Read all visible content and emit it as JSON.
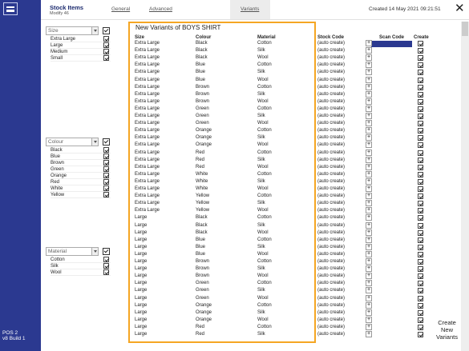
{
  "sidebar": {
    "pos_line1": "POS 2",
    "pos_line2": "v8 Build 1"
  },
  "header": {
    "title": "Stock Items",
    "subtitle": "Modify 46",
    "tabs": [
      "General",
      "Advanced",
      "",
      "Variants"
    ],
    "created": "Created 14 May 2021 09:21:51"
  },
  "filters": {
    "size": {
      "label": "Size",
      "items": [
        "Extra Large",
        "Large",
        "Medium",
        "Small"
      ]
    },
    "colour": {
      "label": "Colour",
      "items": [
        "Black",
        "Blue",
        "Brown",
        "Green",
        "Orange",
        "Red",
        "White",
        "Yellow"
      ]
    },
    "material": {
      "label": "Material",
      "items": [
        "Cotton",
        "Silk",
        "Wool"
      ]
    }
  },
  "grid": {
    "title": "New Variants of BOYS SHIRT",
    "headers": {
      "size": "Size",
      "colour": "Colour",
      "material": "Material",
      "stock_code": "Stock Code",
      "scan_code": "Scan Code",
      "create": "Create"
    },
    "auto_text": "(auto create)",
    "rows": [
      [
        "Extra Large",
        "Black",
        "Cotton"
      ],
      [
        "Extra Large",
        "Black",
        "Silk"
      ],
      [
        "Extra Large",
        "Black",
        "Wool"
      ],
      [
        "Extra Large",
        "Blue",
        "Cotton"
      ],
      [
        "Extra Large",
        "Blue",
        "Silk"
      ],
      [
        "Extra Large",
        "Blue",
        "Wool"
      ],
      [
        "Extra Large",
        "Brown",
        "Cotton"
      ],
      [
        "Extra Large",
        "Brown",
        "Silk"
      ],
      [
        "Extra Large",
        "Brown",
        "Wool"
      ],
      [
        "Extra Large",
        "Green",
        "Cotton"
      ],
      [
        "Extra Large",
        "Green",
        "Silk"
      ],
      [
        "Extra Large",
        "Green",
        "Wool"
      ],
      [
        "Extra Large",
        "Orange",
        "Cotton"
      ],
      [
        "Extra Large",
        "Orange",
        "Silk"
      ],
      [
        "Extra Large",
        "Orange",
        "Wool"
      ],
      [
        "Extra Large",
        "Red",
        "Cotton"
      ],
      [
        "Extra Large",
        "Red",
        "Silk"
      ],
      [
        "Extra Large",
        "Red",
        "Wool"
      ],
      [
        "Extra Large",
        "White",
        "Cotton"
      ],
      [
        "Extra Large",
        "White",
        "Silk"
      ],
      [
        "Extra Large",
        "White",
        "Wool"
      ],
      [
        "Extra Large",
        "Yellow",
        "Cotton"
      ],
      [
        "Extra Large",
        "Yellow",
        "Silk"
      ],
      [
        "Extra Large",
        "Yellow",
        "Wool"
      ],
      [
        "Large",
        "Black",
        "Cotton"
      ],
      [
        "Large",
        "Black",
        "Silk"
      ],
      [
        "Large",
        "Black",
        "Wool"
      ],
      [
        "Large",
        "Blue",
        "Cotton"
      ],
      [
        "Large",
        "Blue",
        "Silk"
      ],
      [
        "Large",
        "Blue",
        "Wool"
      ],
      [
        "Large",
        "Brown",
        "Cotton"
      ],
      [
        "Large",
        "Brown",
        "Silk"
      ],
      [
        "Large",
        "Brown",
        "Wool"
      ],
      [
        "Large",
        "Green",
        "Cotton"
      ],
      [
        "Large",
        "Green",
        "Silk"
      ],
      [
        "Large",
        "Green",
        "Wool"
      ],
      [
        "Large",
        "Orange",
        "Cotton"
      ],
      [
        "Large",
        "Orange",
        "Silk"
      ],
      [
        "Large",
        "Orange",
        "Wool"
      ],
      [
        "Large",
        "Red",
        "Cotton"
      ],
      [
        "Large",
        "Red",
        "Silk"
      ]
    ]
  },
  "create_button": {
    "line1": "Create",
    "line2": "New",
    "line3": "Variants"
  },
  "colors": {
    "sidebar": "#2b3990",
    "highlight_border": "#f5a623",
    "scan_active": "#2b3990"
  }
}
